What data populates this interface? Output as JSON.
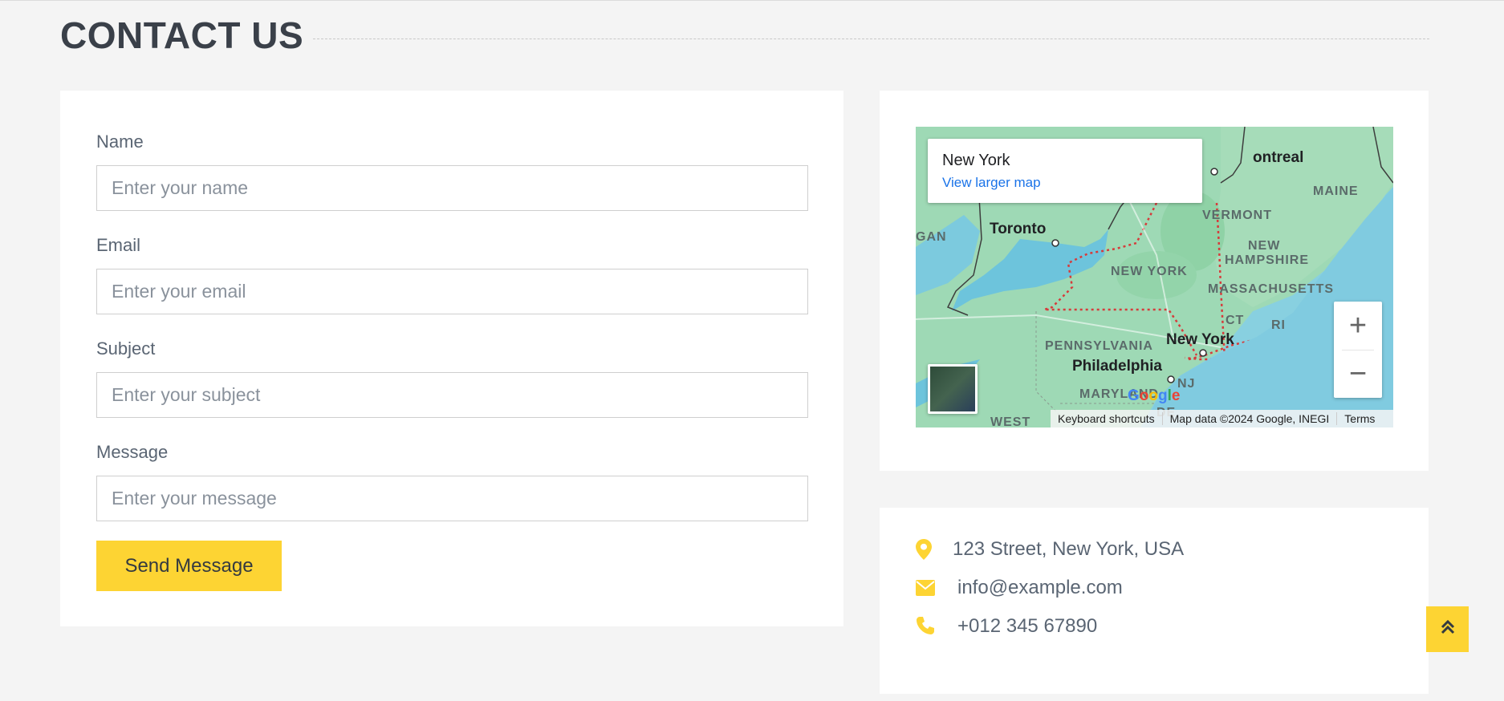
{
  "section": {
    "title": "CONTACT US"
  },
  "form": {
    "name_label": "Name",
    "name_placeholder": "Enter your name",
    "email_label": "Email",
    "email_placeholder": "Enter your email",
    "subject_label": "Subject",
    "subject_placeholder": "Enter your subject",
    "message_label": "Message",
    "message_placeholder": "Enter your message",
    "submit_label": "Send Message"
  },
  "map": {
    "place_name": "New York",
    "view_larger": "View larger map",
    "labels": {
      "montreal": "ontreal",
      "maine": "MAINE",
      "vermont": "VERMONT",
      "michigan": "GAN",
      "toronto": "Toronto",
      "new_hampshire_1": "NEW",
      "new_hampshire_2": "HAMPSHIRE",
      "new_york_state": "NEW YORK",
      "massachusetts": "MASSACHUSETTS",
      "ct": "CT",
      "ri": "RI",
      "pennsylvania": "PENNSYLVANIA",
      "new_york_city": "New York",
      "philadelphia": "Philadelphia",
      "nj": "NJ",
      "maryland": "MARYLAND",
      "west": "WEST",
      "de": "DE"
    },
    "zoom_in": "+",
    "zoom_out": "−",
    "footer": {
      "shortcuts": "Keyboard shortcuts",
      "attribution": "Map data ©2024 Google, INEGI",
      "terms": "Terms"
    },
    "logo": [
      "G",
      "o",
      "o",
      "g",
      "l",
      "e"
    ]
  },
  "contact_info": {
    "address": "123 Street, New York, USA",
    "email": "info@example.com",
    "phone": "+012 345 67890",
    "icon_color": "#fdd433"
  },
  "colors": {
    "accent": "#fdd433",
    "background": "#f4f4f4",
    "card": "#ffffff",
    "text": "#5a6573",
    "heading": "#3a4049",
    "link": "#1a73e8"
  },
  "icons": {
    "address": "map-marker-icon",
    "email": "envelope-icon",
    "phone": "phone-icon",
    "back_to_top": "double-chevron-up-icon"
  }
}
